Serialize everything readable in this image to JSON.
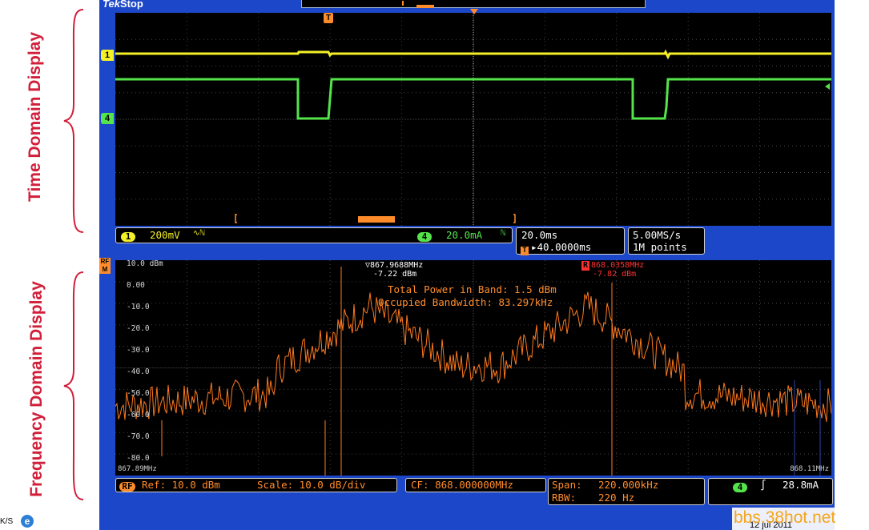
{
  "labels": {
    "time_domain": "Time Domain Display",
    "frequency_domain": "Frequency Domain Display"
  },
  "scope": {
    "brand": "Tek",
    "state": "Stop",
    "trigger_marker": "T"
  },
  "time_panel": {
    "ch1": {
      "number": "1",
      "scale": "200mV",
      "coupling": "∿ℕ"
    },
    "ch4": {
      "number": "4",
      "scale": "20.0mA",
      "coupling": "ℕ"
    },
    "horizontal": {
      "scale": "20.0ms",
      "position": "▸40.0000ms"
    },
    "acquisition": {
      "rate": "5.00MS/s",
      "points": "1M points"
    }
  },
  "freq_panel": {
    "rf_marker": "RF",
    "y_ticks": [
      "10.0 dBm",
      "0.00",
      "-10.0",
      "-20.0",
      "-30.0",
      "-40.0",
      "-50.0",
      "-60.0",
      "-70.0",
      "-80.0"
    ],
    "x_start": "867.89MHz",
    "x_end": "868.11MHz",
    "marker1": {
      "freq": "▽867.9688MHz",
      "level": "-7.22 dBm"
    },
    "marker2": {
      "label": "R",
      "freq": "868.0358MHz",
      "level": "-7.82 dBm"
    },
    "measurement": {
      "total_power": "Total Power in Band: 1.5 dBm",
      "occupied_bw": "Occupied Bandwidth: 83.297kHz"
    },
    "status": {
      "ref": "Ref: 10.0 dBm",
      "scale": "Scale: 10.0 dB/div",
      "cf": "CF: 868.000000MHz",
      "span_label": "Span:",
      "span_value": "220.000kHz",
      "rbw_label": "RBW:",
      "rbw_value": "220 Hz",
      "trigger_ch": "4",
      "trigger_slope": "∫",
      "trigger_level": "28.8mA"
    }
  },
  "taskbar": {
    "text": "K/S"
  },
  "watermark": {
    "text": "bbs.38hot.net",
    "date": "12 jul 2011"
  },
  "colors": {
    "ch1": "#f3f028",
    "ch4": "#54e34a",
    "rf": "#ff8c2a",
    "scope_blue": "#1c47c9",
    "label_red": "#d11f3a"
  }
}
